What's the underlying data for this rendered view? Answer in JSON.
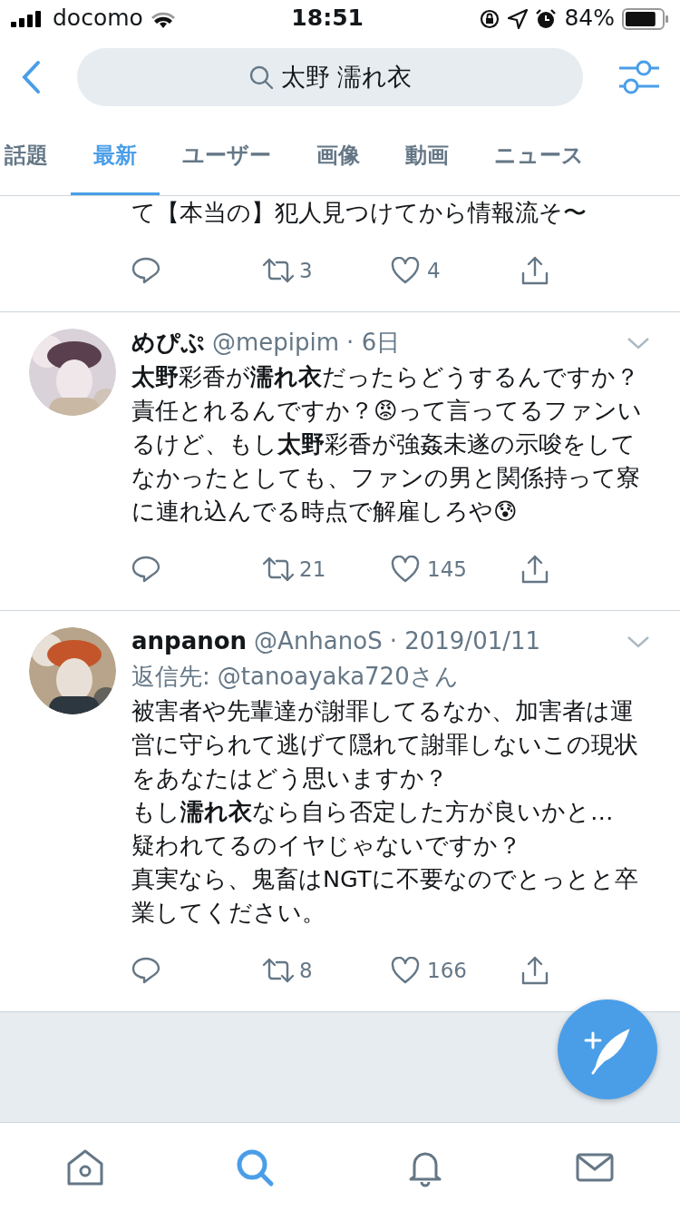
{
  "status_bar": {
    "carrier": "docomo",
    "time": "18:51",
    "battery": "84%"
  },
  "search": {
    "query": "太野 濡れ衣"
  },
  "tabs": [
    {
      "label": "話題",
      "selected": false
    },
    {
      "label": "最新",
      "selected": true
    },
    {
      "label": "ユーザー",
      "selected": false
    },
    {
      "label": "画像",
      "selected": false
    },
    {
      "label": "動画",
      "selected": false
    },
    {
      "label": "ニュース",
      "selected": false
    }
  ],
  "tweets": [
    {
      "kind": "partial",
      "text": "て【本当の】犯人見つけてから情報流そ〜",
      "retweets": "3",
      "likes": "4"
    },
    {
      "kind": "full",
      "name": "めぴぷ",
      "handle": "@mepipim",
      "time": "· 6日",
      "text": "**太野**彩香が**濡れ衣**だったらどうするんですか？責任とれるんですか？😡って言ってるファンいるけど、もし**太野**彩香が強姦未遂の示唆をしてなかったとしても、ファンの男と関係持って寮に連れ込んでる時点で解雇しろや😰",
      "retweets": "21",
      "likes": "145"
    },
    {
      "kind": "full",
      "name": "anpanon",
      "handle": "@AnhanoS",
      "time": "· 2019/01/11",
      "reply_label": "返信先:",
      "reply_to": "@tanoayaka720さん",
      "paragraphs": [
        "被害者や先輩達が謝罪してるなか、加害者は運営に守られて逃げて隠れて謝罪しないこの現状をあなたはどう思いますか？",
        "もし**濡れ衣**なら自ら否定した方が良いかと…",
        "疑われてるのイヤじゃないですか？",
        "真実なら、鬼畜はNGTに不要なのでとっとと卒業してください。"
      ],
      "retweets": "8",
      "likes": "166"
    }
  ],
  "bottom_nav": [
    {
      "kind": "home",
      "selected": false
    },
    {
      "kind": "search",
      "selected": true
    },
    {
      "kind": "notifications",
      "selected": false
    },
    {
      "kind": "messages",
      "selected": false
    }
  ]
}
